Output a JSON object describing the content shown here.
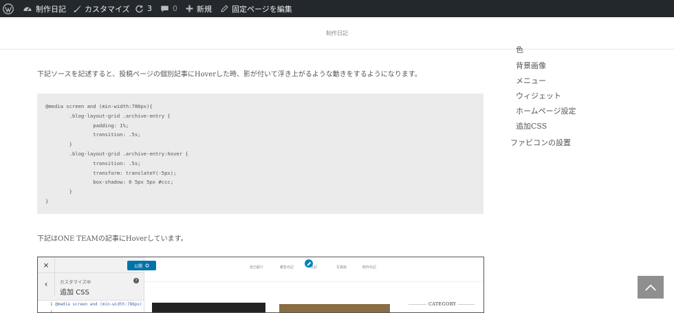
{
  "admin_bar": {
    "site_name": "制作日記",
    "customize": "カスタマイズ",
    "updates_count": "3",
    "comments_count": "0",
    "new_label": "新規",
    "edit_page": "固定ページを編集"
  },
  "site": {
    "title": "制作日記"
  },
  "article": {
    "intro": "下記ソースを記述すると、投稿ページの個別記事にHoverした時、影が付いて浮き上がるような動きをするようになります。",
    "code": "@media screen and (min-width:786px){\n        .blog-layout-grid .archive-entry {\n                padding: 1%;\n                transition: .5s;\n        }\n        .blog-layout-grid .archive-entry:hover {\n                transition: .5s;\n                transform: translateY(-5px);\n                box-shadow: 0 5px 5px #ccc;\n        }\n}",
    "outro": "下記はONE TEAMの記事にHoverしています。"
  },
  "sidebar": {
    "partial_item": "色",
    "items": [
      "背景画像",
      "メニュー",
      "ウィジェット",
      "ホームページ設定",
      "追加CSS"
    ],
    "favicon": "ファビコンの設置"
  },
  "embedded_screenshot": {
    "close": "×",
    "publish": "公開",
    "back": "‹",
    "customizing_label": "カスタマイズ中",
    "section_title": "追加 CSS",
    "code_line": "1 @media screen and (min-width:786px){",
    "nav": [
      "自己紹介",
      "報告日記",
      "日記",
      "写真館",
      "制作日記"
    ],
    "category": "CATEGORY"
  },
  "icons": {
    "wp_logo": "wordpress-icon",
    "dashboard": "dashboard-icon",
    "brush": "brush-icon",
    "updates": "refresh-icon",
    "comments": "comment-icon",
    "new": "plus-icon",
    "edit": "pencil-icon",
    "to_top": "chevron-up-icon"
  },
  "colors": {
    "admin_bar_bg": "#23282d",
    "code_bg": "#ebebeb",
    "publish_blue": "#0073aa",
    "to_top_bg": "#8f8f8f"
  }
}
